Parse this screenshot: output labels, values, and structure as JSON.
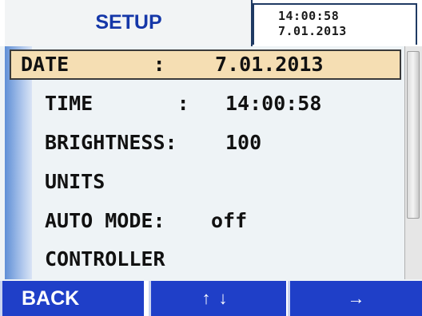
{
  "header": {
    "title": "SETUP",
    "clock_time": "14:00:58",
    "clock_date": "7.01.2013"
  },
  "menu": {
    "items": [
      {
        "label": "DATE       :",
        "value": " 7.01.2013",
        "selected": true
      },
      {
        "label": "TIME       :",
        "value": "14:00:58",
        "selected": false
      },
      {
        "label": "BRIGHTNESS:",
        "value": "100",
        "selected": false
      },
      {
        "label": "UNITS",
        "value": "",
        "selected": false
      },
      {
        "label": "AUTO MODE:",
        "value": "off",
        "selected": false
      },
      {
        "label": "CONTROLLER",
        "value": "",
        "selected": false
      }
    ]
  },
  "softkeys": {
    "back": "BACK",
    "updown": "↑↓",
    "next": "→"
  }
}
